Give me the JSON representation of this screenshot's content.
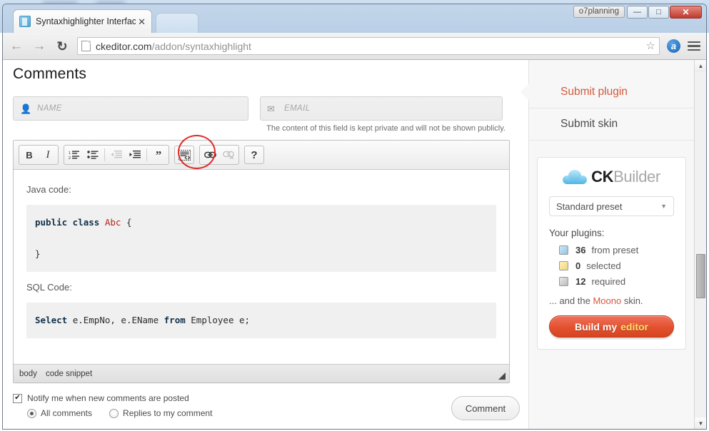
{
  "watermark": {
    "text": "o7planning"
  },
  "browser": {
    "tab": {
      "title": "Syntaxhighlighter Interfac",
      "close_glyph": "✕"
    },
    "window": {
      "minimize_glyph": "—",
      "maximize_glyph": "□",
      "close_glyph": "✕"
    },
    "nav": {
      "back_glyph": "←",
      "forward_glyph": "→",
      "reload_glyph": "↻",
      "star_glyph": "☆"
    },
    "url": {
      "domain": "ckeditor.com",
      "path": "/addon/syntaxhighlight"
    },
    "extension": {
      "label": "a"
    },
    "scrollbar": {
      "up_glyph": "▲",
      "down_glyph": "▼"
    }
  },
  "page": {
    "heading": "Comments",
    "form": {
      "name_placeholder": "NAME",
      "email_placeholder": "EMAIL",
      "privacy_note": "The content of this field is kept private and will not be shown publicly."
    },
    "options": {
      "check_glyph": "✔",
      "notify_label": "Notify me when new comments are posted",
      "radio_all": "All comments",
      "radio_replies": "Replies to my comment",
      "submit_label": "Comment"
    }
  },
  "editor": {
    "toolbar": [
      {
        "name": "bold",
        "label": "B"
      },
      {
        "name": "italic",
        "label": "I"
      },
      {
        "name": "numbered-list",
        "label": "Numbered List"
      },
      {
        "name": "bulleted-list",
        "label": "Bulleted List"
      },
      {
        "name": "outdent",
        "label": "Decrease Indent"
      },
      {
        "name": "indent",
        "label": "Increase Indent"
      },
      {
        "name": "blockquote",
        "label": "Block Quote"
      },
      {
        "name": "code-snippet",
        "label": "Insert Code Snippet"
      },
      {
        "name": "link",
        "label": "Link"
      },
      {
        "name": "unlink",
        "label": "Unlink"
      },
      {
        "name": "help",
        "label": "?"
      }
    ],
    "body": {
      "java_label": "Java code:",
      "java_code": {
        "keyword": "public class",
        "classname": "Abc",
        "open_brace": "{",
        "close_brace": "}"
      },
      "sql_label": "SQL Code:",
      "sql_code": {
        "select": "Select",
        "columns": "e.EmpNo, e.EName",
        "from": "from",
        "table": "Employee e;"
      }
    },
    "path": [
      "body",
      "code snippet"
    ]
  },
  "sidebar": {
    "links": [
      {
        "label": "Submit plugin"
      },
      {
        "label": "Submit skin"
      }
    ],
    "ckbuilder": {
      "logo_bold": "CK",
      "logo_light": "Builder",
      "preset_value": "Standard preset",
      "plugins_title": "Your plugins:",
      "plugins": [
        {
          "count": "36",
          "label": "from preset"
        },
        {
          "count": "0",
          "label": "selected"
        },
        {
          "count": "12",
          "label": "required"
        }
      ],
      "skin": {
        "prefix": "... and the",
        "name": "Moono",
        "suffix": " skin."
      },
      "build_button": {
        "text": "Build my ",
        "accent": "editor"
      }
    }
  },
  "colors": {
    "accent_orange": "#d2593b",
    "build_button": "#e2512f",
    "annotation_red": "#e02a2a",
    "code_class_red": "#b3261e",
    "code_keyword": "#12304a",
    "code_bg": "#f0f0f0"
  }
}
